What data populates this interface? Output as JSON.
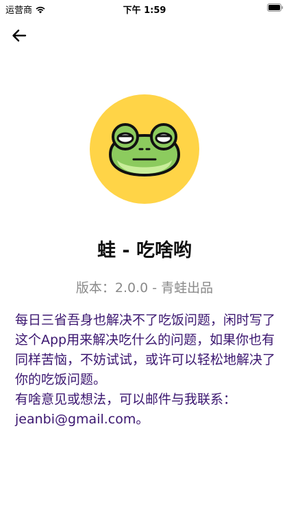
{
  "status_bar": {
    "carrier": "运营商",
    "time": "下午 1:59",
    "icons": [
      "wifi-icon",
      "battery-icon"
    ]
  },
  "nav": {
    "back_icon": "arrow-left-icon"
  },
  "app": {
    "icon_name": "frog-logo-icon",
    "icon_bg": "#FFD447",
    "name": "蛙 - 吃啥哟",
    "version": "版本：2.0.0 - 青蛙出品"
  },
  "description": {
    "line1": "每日三省吾身也解决不了吃饭问题，闲时写了这个App用来解决吃什么的问题，如果你也有同样苦恼，不妨试试，或许可以轻松地解决了你的吃饭问题。",
    "line2": "有啥意见或想法，可以邮件与我联系：jeanbi@gmail.com。"
  },
  "colors": {
    "description_text": "#3b1670",
    "version_text": "#8a8a8a",
    "frog_green": "#8CCB5E",
    "frog_belly": "#C9EE9A"
  }
}
